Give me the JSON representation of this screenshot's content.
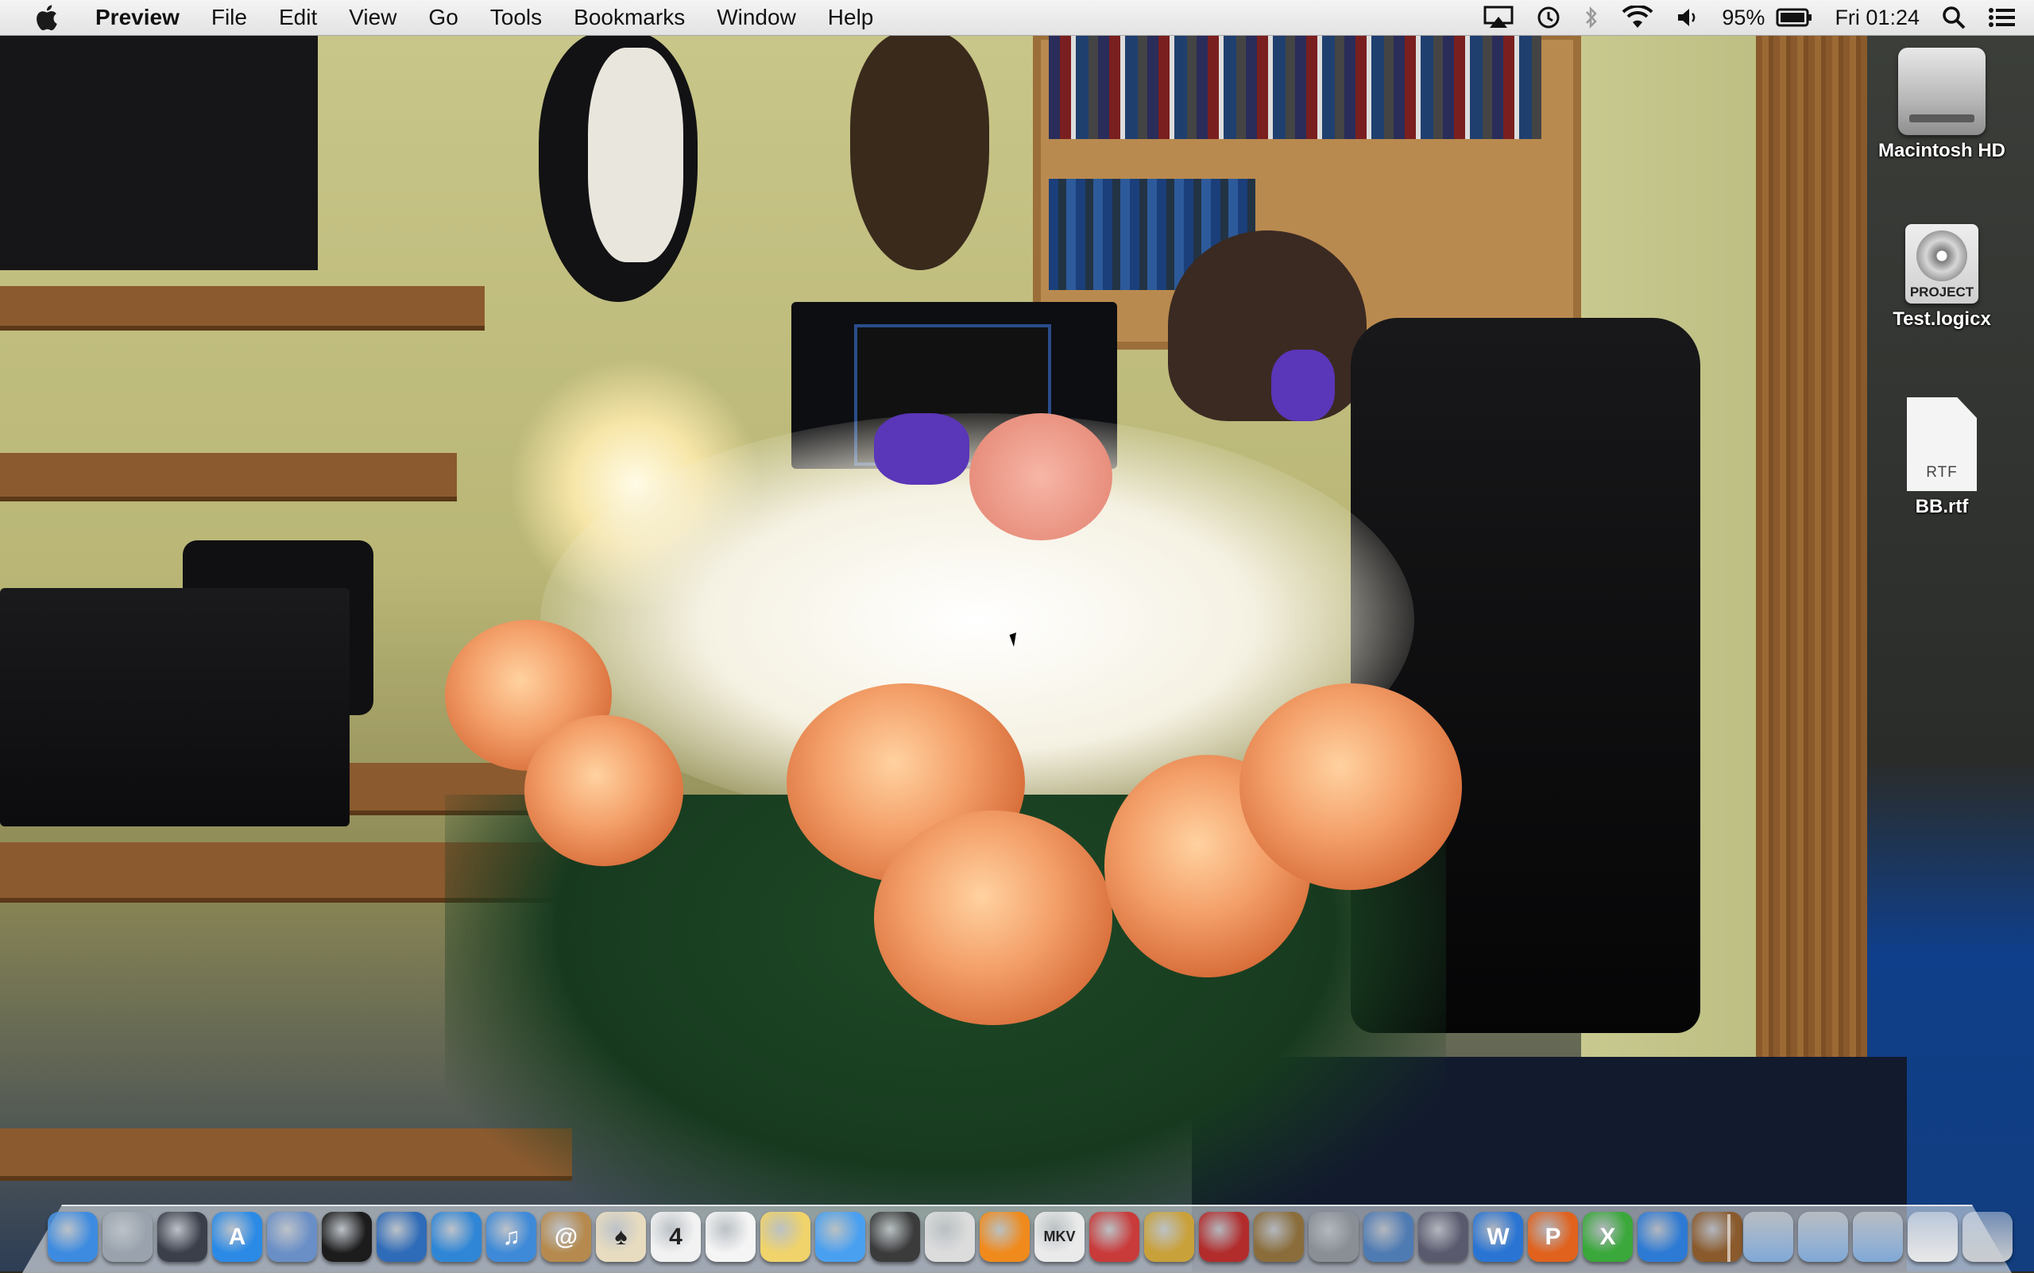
{
  "menubar": {
    "app_name": "Preview",
    "menus": [
      "File",
      "Edit",
      "View",
      "Go",
      "Tools",
      "Bookmarks",
      "Window",
      "Help"
    ],
    "status": {
      "battery_percent": "95%",
      "clock": "Fri 01:24",
      "icons": [
        "airplay-icon",
        "time-machine-icon",
        "bluetooth-icon",
        "wifi-icon",
        "volume-icon",
        "battery-icon",
        "spotlight-icon",
        "notification-center-icon"
      ]
    }
  },
  "desktop": {
    "icons": [
      {
        "name": "macintosh-hd-icon",
        "label": "Macintosh HD"
      },
      {
        "name": "logic-project-icon",
        "label": "Test.logicx",
        "badge": "PROJECT"
      },
      {
        "name": "rtf-document-icon",
        "label": "BB.rtf",
        "badge": "RTF"
      }
    ]
  },
  "dock": {
    "apps": [
      {
        "name": "finder-icon",
        "glyph": "",
        "color": "#3d8be0"
      },
      {
        "name": "launchpad-icon",
        "glyph": "",
        "color": "#9aa3ad"
      },
      {
        "name": "mission-control-icon",
        "glyph": "",
        "color": "#3a3f4a"
      },
      {
        "name": "app-store-icon",
        "glyph": "A",
        "color": "#2a8ae6"
      },
      {
        "name": "mail-stamp-icon",
        "glyph": "",
        "color": "#6a8fc7"
      },
      {
        "name": "facetime-icon",
        "glyph": "",
        "color": "#1c1c1c"
      },
      {
        "name": "thunderbird-icon",
        "glyph": "",
        "color": "#2e6bb8"
      },
      {
        "name": "safari-icon",
        "glyph": "",
        "color": "#2f86d6"
      },
      {
        "name": "itunes-icon",
        "glyph": "♫",
        "color": "#3f8ad8"
      },
      {
        "name": "address-book-icon",
        "glyph": "@",
        "color": "#b68a4e"
      },
      {
        "name": "solitaire-icon",
        "glyph": "♠",
        "color": "#e8dcc0"
      },
      {
        "name": "calendar-icon",
        "glyph": "4",
        "color": "#f2f2f2"
      },
      {
        "name": "reminders-icon",
        "glyph": "",
        "color": "#f5f5f5"
      },
      {
        "name": "notes-icon",
        "glyph": "",
        "color": "#f0d36a"
      },
      {
        "name": "messages-icon",
        "glyph": "",
        "color": "#4aa0f0"
      },
      {
        "name": "photo-booth-icon",
        "glyph": "",
        "color": "#3b3b3b"
      },
      {
        "name": "preview-icon",
        "glyph": "",
        "color": "#dcdcdc"
      },
      {
        "name": "vlc-icon",
        "glyph": "",
        "color": "#f08a1c"
      },
      {
        "name": "mkv-icon",
        "glyph": "MKV",
        "color": "#eaeaea"
      },
      {
        "name": "cocktail-icon",
        "glyph": "",
        "color": "#c93a3a"
      },
      {
        "name": "pineapple-icon",
        "glyph": "",
        "color": "#c9a13a"
      },
      {
        "name": "movie-icon",
        "glyph": "",
        "color": "#b22c2c"
      },
      {
        "name": "iphoto-icon",
        "glyph": "",
        "color": "#8a6d3b"
      },
      {
        "name": "system-preferences-icon",
        "glyph": "",
        "color": "#8a8f96"
      },
      {
        "name": "scanner-icon",
        "glyph": "",
        "color": "#4f7bb3"
      },
      {
        "name": "grapher-icon",
        "glyph": "",
        "color": "#5a5a6e"
      },
      {
        "name": "word-icon",
        "glyph": "W",
        "color": "#2a75d4"
      },
      {
        "name": "powerpoint-icon",
        "glyph": "P",
        "color": "#e0621d"
      },
      {
        "name": "excel-icon",
        "glyph": "X",
        "color": "#3aa83a"
      },
      {
        "name": "network-globe-icon",
        "glyph": "",
        "color": "#2d7ad4"
      },
      {
        "name": "garageband-icon",
        "glyph": "",
        "color": "#8a5a2c"
      }
    ],
    "right": [
      {
        "name": "applications-folder-icon",
        "color": "#7fa8d6"
      },
      {
        "name": "documents-folder-icon",
        "color": "#7fa8d6"
      },
      {
        "name": "downloads-folder-icon",
        "color": "#7fa8d6"
      },
      {
        "name": "document-stack-icon",
        "color": "#e8e8e8"
      },
      {
        "name": "trash-icon",
        "color": "#c9ccd0"
      }
    ]
  },
  "colors": {
    "menubar_bg": "#ececec",
    "desktop_label": "#ffffff"
  }
}
